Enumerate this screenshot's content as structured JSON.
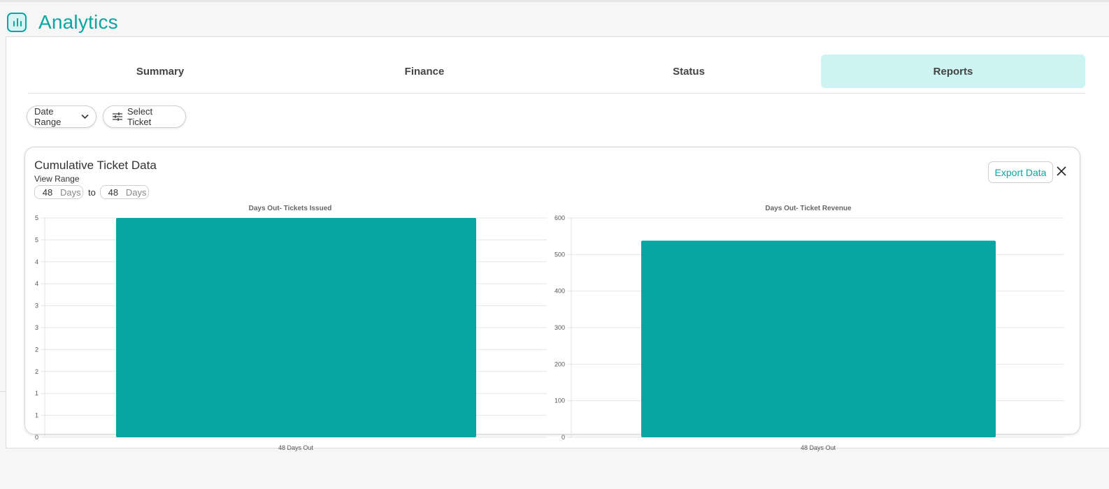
{
  "app": {
    "title": "Analytics",
    "logo_icon": "bar-chart-icon"
  },
  "tabs": [
    {
      "label": "Summary",
      "active": false
    },
    {
      "label": "Finance",
      "active": false
    },
    {
      "label": "Status",
      "active": false
    },
    {
      "label": "Reports",
      "active": true
    }
  ],
  "filters": {
    "date_range_label": "Date Range",
    "date_range_icon": "chevron-down-icon",
    "select_ticket_label": "Select Ticket",
    "select_ticket_icon": "sliders-icon"
  },
  "card": {
    "title": "Cumulative Ticket Data",
    "view_range_label": "View Range",
    "range_from_value": "48",
    "range_from_unit": "Days",
    "range_to_label": "to",
    "range_to_value": "48",
    "range_to_unit": "Days",
    "export_label": "Export Data",
    "close_icon": "close-icon"
  },
  "colors": {
    "accent": "#0aa6a2",
    "active_tab_bg": "#cdf3f2",
    "bar": "#09a6a1"
  },
  "chart_data": [
    {
      "type": "bar",
      "title": "Days Out- Tickets Issued",
      "categories": [
        "48 Days Out"
      ],
      "values": [
        5
      ],
      "ylim": [
        0,
        5
      ],
      "yticks": [
        "0",
        "1",
        "1",
        "2",
        "2",
        "3",
        "3",
        "4",
        "4",
        "5",
        "5"
      ],
      "grid": true,
      "legend": "none"
    },
    {
      "type": "bar",
      "title": "Days Out- Ticket Revenue",
      "categories": [
        "48 Days Out"
      ],
      "values": [
        538
      ],
      "ylim": [
        0,
        600
      ],
      "yticks": [
        "0",
        "100",
        "200",
        "300",
        "400",
        "500",
        "600"
      ],
      "grid": true,
      "legend": "none"
    }
  ]
}
